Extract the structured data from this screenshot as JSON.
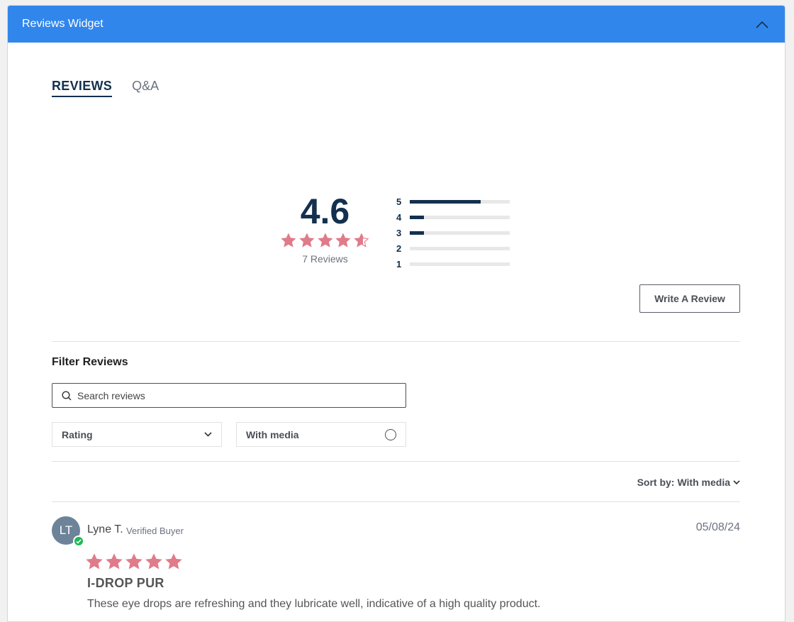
{
  "widget": {
    "title": "Reviews Widget"
  },
  "tabs": [
    {
      "label": "REVIEWS",
      "active": true
    },
    {
      "label": "Q&A",
      "active": false
    }
  ],
  "summary": {
    "average": "4.6",
    "average_value": 4.6,
    "reviews_count": "7 Reviews",
    "star_color": "#e07b8a",
    "distribution": [
      {
        "stars": "5",
        "fraction": 0.71
      },
      {
        "stars": "4",
        "fraction": 0.14
      },
      {
        "stars": "3",
        "fraction": 0.14
      },
      {
        "stars": "2",
        "fraction": 0
      },
      {
        "stars": "1",
        "fraction": 0
      }
    ]
  },
  "write_review": {
    "label": "Write A Review"
  },
  "filter": {
    "title": "Filter Reviews",
    "search_placeholder": "Search reviews",
    "rating_label": "Rating",
    "media_label": "With media"
  },
  "sort": {
    "prefix": "Sort by:",
    "value": "With media"
  },
  "reviews": [
    {
      "initials": "LT",
      "name": "Lyne T.",
      "badge": "Verified Buyer",
      "date": "05/08/24",
      "rating": 5,
      "title": "I-DROP PUR",
      "body": "These eye drops are refreshing and they lubricate well, indicative of a high quality product."
    }
  ],
  "icons": {
    "collapse": "chevron-up-icon",
    "search": "search-icon",
    "dropdown": "chevron-down-icon",
    "radio": "radio-icon",
    "verified": "check-icon"
  }
}
